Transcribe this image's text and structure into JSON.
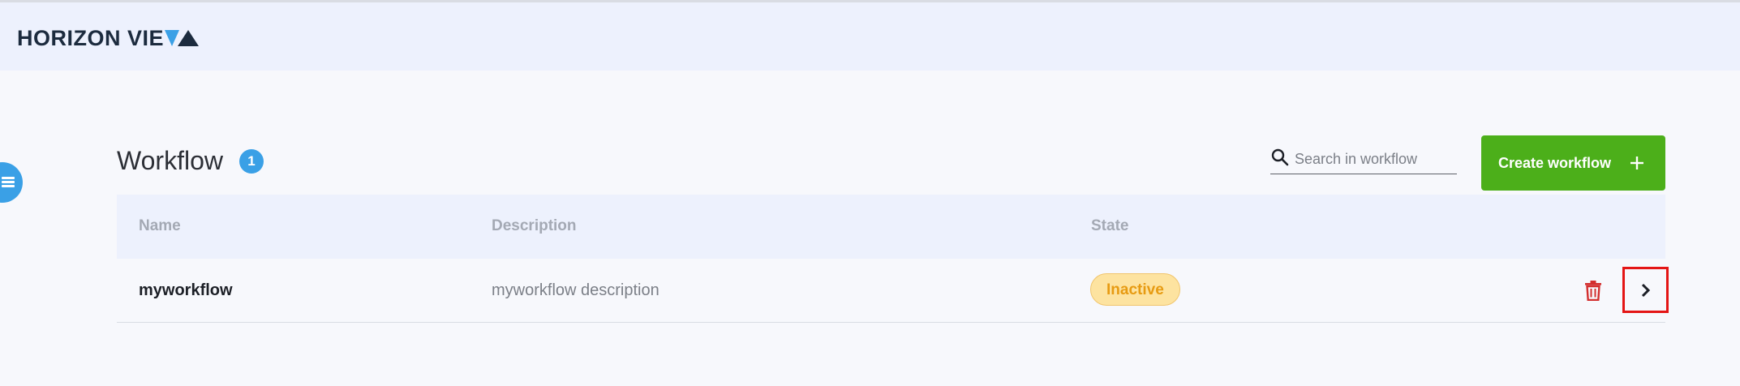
{
  "header": {
    "logo_text": "HORIZON VIE",
    "logo_mark_icon": "triangle-logo-icon"
  },
  "sidebar": {
    "toggle_icon": "hamburger-menu-icon"
  },
  "page": {
    "title": "Workflow",
    "count": "1"
  },
  "search": {
    "placeholder": "Search in workflow",
    "value": "",
    "icon": "search-icon"
  },
  "actions": {
    "create_label": "Create workflow",
    "create_icon": "plus-icon"
  },
  "table": {
    "columns": [
      "Name",
      "Description",
      "State"
    ],
    "rows": [
      {
        "name": "myworkflow",
        "description": "myworkflow description",
        "state": "Inactive",
        "delete_icon": "trash-icon",
        "open_icon": "chevron-right-icon"
      }
    ]
  },
  "colors": {
    "accent_blue": "#3aa0e6",
    "create_green": "#4caf1a",
    "inactive_bg": "#fde3a0",
    "inactive_text": "#e79b12",
    "delete_red": "#d32f2f",
    "highlight_red": "#e41515"
  }
}
